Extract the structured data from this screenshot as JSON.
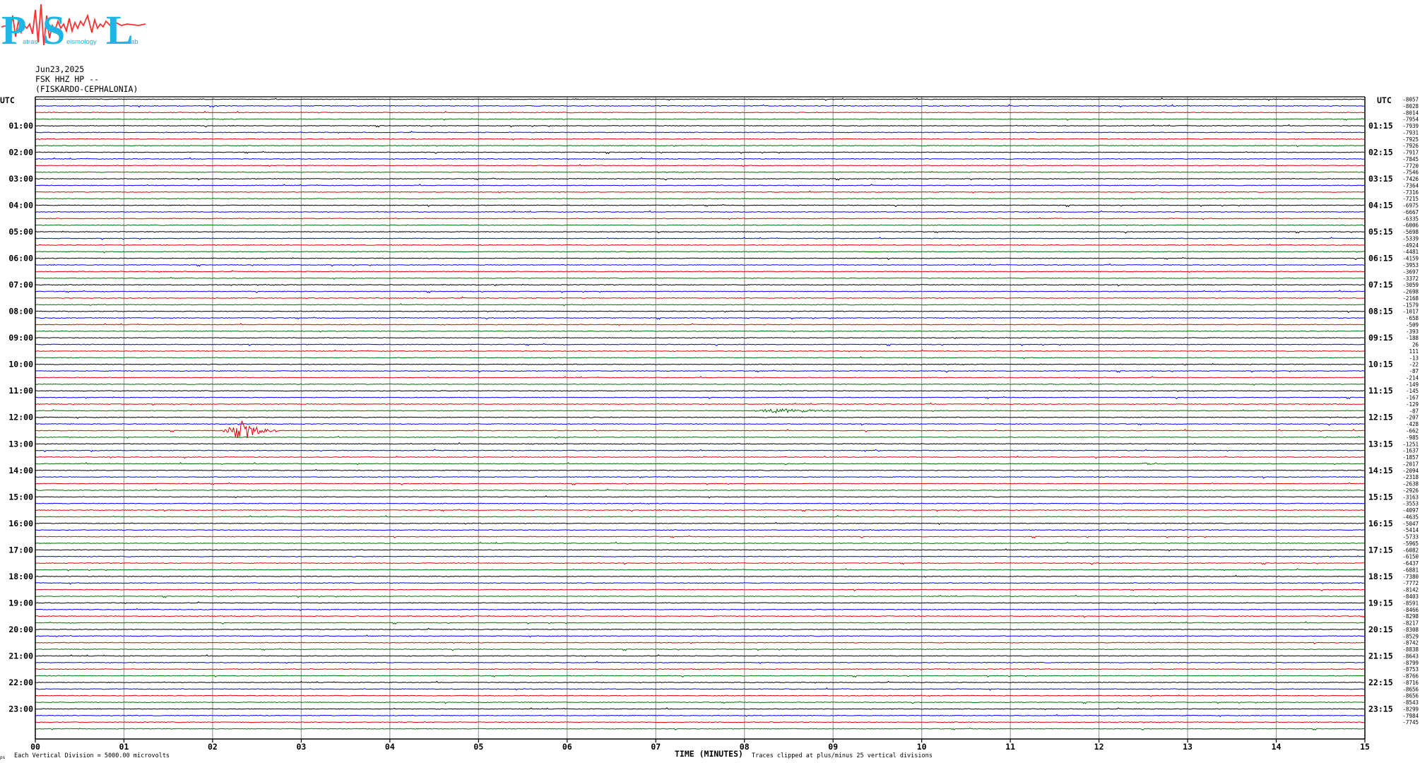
{
  "logo": {
    "letters": [
      "P",
      "S",
      "L"
    ],
    "words": [
      "atras",
      "eismology",
      "ab"
    ],
    "colors": {
      "letters": "#1fb6e6",
      "wave": "#ff3030"
    }
  },
  "header": {
    "date": "Jun23,2025",
    "station": "FSK HHZ HP --",
    "location": "(FISKARDO-CEPHALONIA)"
  },
  "footer": {
    "corner_mark": "ps",
    "scale_note": "Each Vertical Division = 5000.00 microvolts",
    "clip_note": "Traces clipped at plus/minus 25 vertical divisions"
  },
  "chart_data": {
    "type": "line",
    "title": "",
    "xlabel": "TIME (MINUTES)",
    "x_ticks": [
      "00",
      "01",
      "02",
      "03",
      "04",
      "05",
      "06",
      "07",
      "08",
      "09",
      "10",
      "11",
      "12",
      "13",
      "14",
      "15"
    ],
    "xlim": [
      0,
      15
    ],
    "left_axis_label": "UTC",
    "right_axis_label": "UTC",
    "left_hour_labels": [
      "01:00",
      "02:00",
      "03:00",
      "04:00",
      "05:00",
      "06:00",
      "07:00",
      "08:00",
      "09:00",
      "10:00",
      "11:00",
      "12:00",
      "13:00",
      "14:00",
      "15:00",
      "16:00",
      "17:00",
      "18:00",
      "19:00",
      "20:00",
      "21:00",
      "22:00",
      "23:00"
    ],
    "right_hour_labels": [
      "01:15",
      "02:15",
      "03:15",
      "04:15",
      "05:15",
      "06:15",
      "07:15",
      "08:15",
      "09:15",
      "10:15",
      "11:15",
      "12:15",
      "13:15",
      "14:15",
      "15:15",
      "16:15",
      "17:15",
      "18:15",
      "19:15",
      "20:15",
      "21:15",
      "22:15",
      "23:15"
    ],
    "trace_color_cycle": [
      "#000000",
      "#0000ff",
      "#e00000",
      "#007000"
    ],
    "trace_count": 96,
    "minutes_per_trace": 15,
    "grid": true,
    "trace_offsets": [
      "-8057",
      "-8028",
      "-8014",
      "-7954",
      "-7939",
      "-7931",
      "-7925",
      "-7926",
      "-7917",
      "-7845",
      "-7720",
      "-7546",
      "-7426",
      "-7364",
      "-7316",
      "-7215",
      "-6975",
      "-6667",
      "-6335",
      "-6006",
      "-5698",
      "-5339",
      "-4924",
      "-4481",
      "-4159",
      "-3953",
      "-3697",
      "-3372",
      "-3059",
      "-2698",
      "-2168",
      "-1579",
      "-1017",
      "-658",
      "-509",
      "-393",
      "-188",
      "26",
      "111",
      "-13",
      "-22",
      "-87",
      "-214",
      "-149",
      "-145",
      "-167",
      "-129",
      "-87",
      "-207",
      "-428",
      "-662",
      "-985",
      "-1251",
      "-1637",
      "-1857",
      "-2017",
      "-2094",
      "-2318",
      "-2638",
      "-2926",
      "-3163",
      "-3553",
      "-4097",
      "-4635",
      "-5047",
      "-5414",
      "-5733",
      "-5965",
      "-6082",
      "-6150",
      "-6437",
      "-6881",
      "-7380",
      "-7772",
      "-8142",
      "-8403",
      "-8591",
      "-8466",
      "-8298",
      "-8217",
      "-8308",
      "-8529",
      "-8742",
      "-8838",
      "-8643",
      "-8799",
      "-8753",
      "-8766",
      "-8716",
      "-8656",
      "-8656",
      "-8543",
      "-8299",
      "-7984",
      "-7745"
    ],
    "events": [
      {
        "trace": 50,
        "start_min": 2.1,
        "peak_min": 2.35,
        "end_min": 2.8,
        "peak_divisions": 1.6
      },
      {
        "trace": 47,
        "start_min": 8.05,
        "peak_min": 8.35,
        "end_min": 9.8,
        "peak_divisions": 0.35
      },
      {
        "trace": 55,
        "start_min": 12.3,
        "peak_min": 12.6,
        "end_min": 12.9,
        "peak_divisions": 0.2
      }
    ]
  }
}
